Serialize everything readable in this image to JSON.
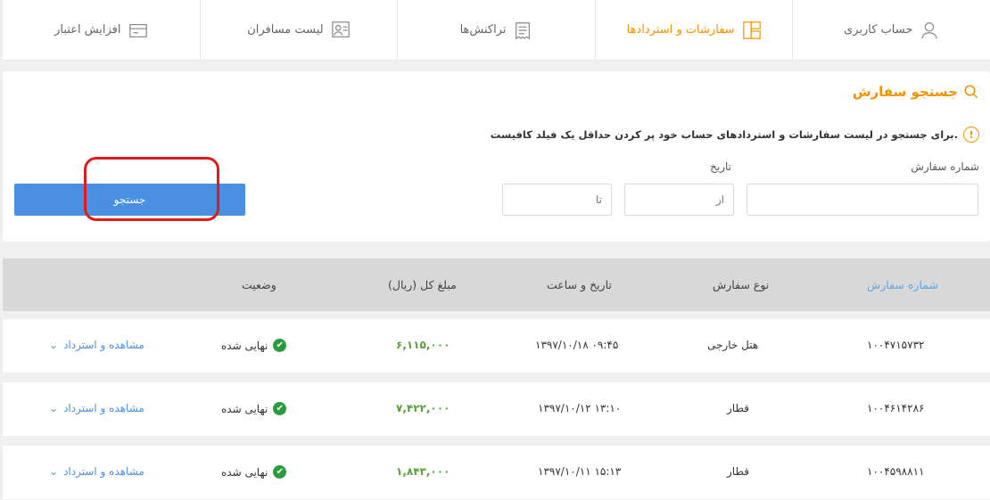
{
  "nav": {
    "tabs": [
      {
        "label": "حساب کاربری",
        "icon": "user-icon",
        "active": false
      },
      {
        "label": "سفارشات و استردادها",
        "icon": "orders-icon",
        "active": true
      },
      {
        "label": "تراکنش‌ها",
        "icon": "receipt-icon",
        "active": false
      },
      {
        "label": "لیست مسافران",
        "icon": "passenger-list-icon",
        "active": false
      },
      {
        "label": "افزایش اعتبار",
        "icon": "credit-card-icon",
        "active": false
      }
    ]
  },
  "search": {
    "title": "جستجو سفارش",
    "info": "برای جستجو در لیست سفارشات و استردادهای حساب خود پر کردن حداقل یک فیلد کافیست.",
    "order_number_label": "شماره سفارش",
    "date_label": "تاریخ",
    "from_placeholder": "از",
    "to_placeholder": "تا",
    "button_label": "جستجو"
  },
  "table": {
    "headers": {
      "order_number": "شماره سفارش",
      "order_type": "نوع سفارش",
      "datetime": "تاریخ و ساعت",
      "amount": "مبلغ کل (ریال)",
      "status": "وضعیت"
    },
    "rows": [
      {
        "order_number": "۱۰۰۴۷۱۵۷۳۲",
        "order_type": "هتل خارجی",
        "datetime": "۱۳۹۷/۱۰/۱۸   ۰۹:۴۵",
        "amount": "۶,۱۱۵,۰۰۰",
        "status": "نهایی شده",
        "action": "مشاهده و استرداد"
      },
      {
        "order_number": "۱۰۰۴۶۱۴۲۸۶",
        "order_type": "قطار",
        "datetime": "۱۳۹۷/۱۰/۱۲   ۱۳:۱۰",
        "amount": "۷,۴۲۲,۰۰۰",
        "status": "نهایی شده",
        "action": "مشاهده و استرداد"
      },
      {
        "order_number": "۱۰۰۴۵۹۸۸۱۱",
        "order_type": "قطار",
        "datetime": "۱۳۹۷/۱۰/۱۱   ۱۵:۱۳",
        "amount": "۱,۸۴۳,۰۰۰",
        "status": "نهایی شده",
        "action": "مشاهده و استرداد"
      }
    ]
  },
  "colors": {
    "accent": "#f39200",
    "primary": "#4a90e2",
    "success": "#2e9a3f",
    "amount": "#5aa03c",
    "annotation": "#e01b1b"
  }
}
